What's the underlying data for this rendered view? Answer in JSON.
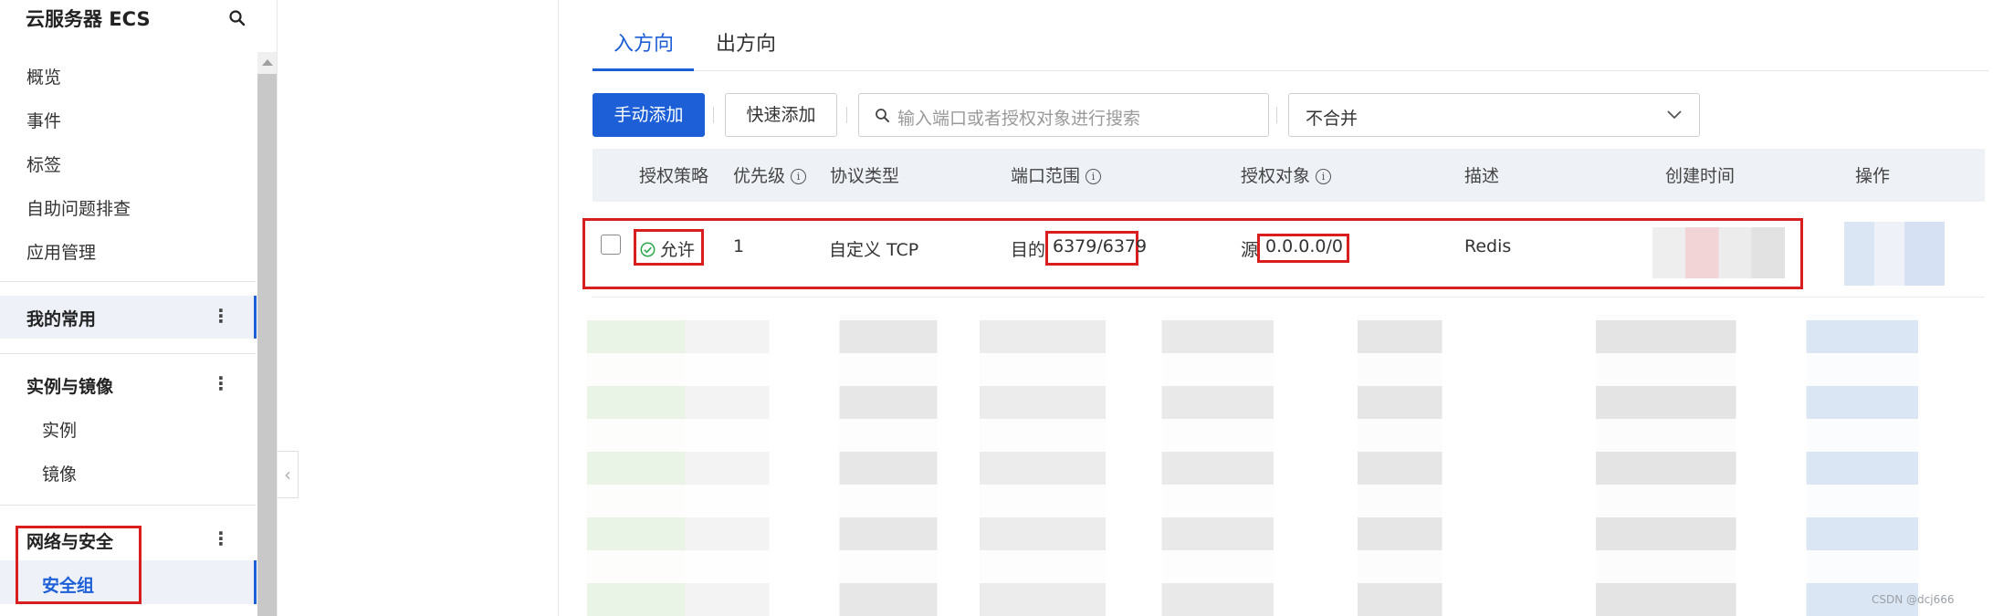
{
  "sidebar": {
    "title": "云服务器 ECS",
    "items": [
      "概览",
      "事件",
      "标签",
      "自助问题排查",
      "应用管理"
    ],
    "groups": {
      "frequent": "我的常用",
      "instance_image": "实例与镜像",
      "network_security": "网络与安全"
    },
    "sub_items": {
      "instance": "实例",
      "image": "镜像",
      "security_group": "安全组"
    }
  },
  "tabs": {
    "inbound": "入方向",
    "outbound": "出方向"
  },
  "toolbar": {
    "manual_add": "手动添加",
    "quick_add": "快速添加",
    "search_placeholder": "输入端口或者授权对象进行搜索",
    "merge_select": "不合并"
  },
  "table": {
    "headers": {
      "policy": "授权策略",
      "priority": "优先级",
      "protocol": "协议类型",
      "port_range": "端口范围",
      "auth_object": "授权对象",
      "description": "描述",
      "created": "创建时间",
      "actions": "操作"
    },
    "rows": [
      {
        "policy": "允许",
        "priority": "1",
        "protocol": "自定义 TCP",
        "port_prefix": "目的",
        "port": "6379/6379",
        "auth_prefix": "源",
        "auth": "0.0.0.0/0",
        "description": "Redis"
      }
    ]
  },
  "watermark": "CSDN @dcj666",
  "colors": {
    "primary": "#1c5fd6",
    "highlight_box": "#d81e1e",
    "allow_green": "#2aa84a"
  }
}
